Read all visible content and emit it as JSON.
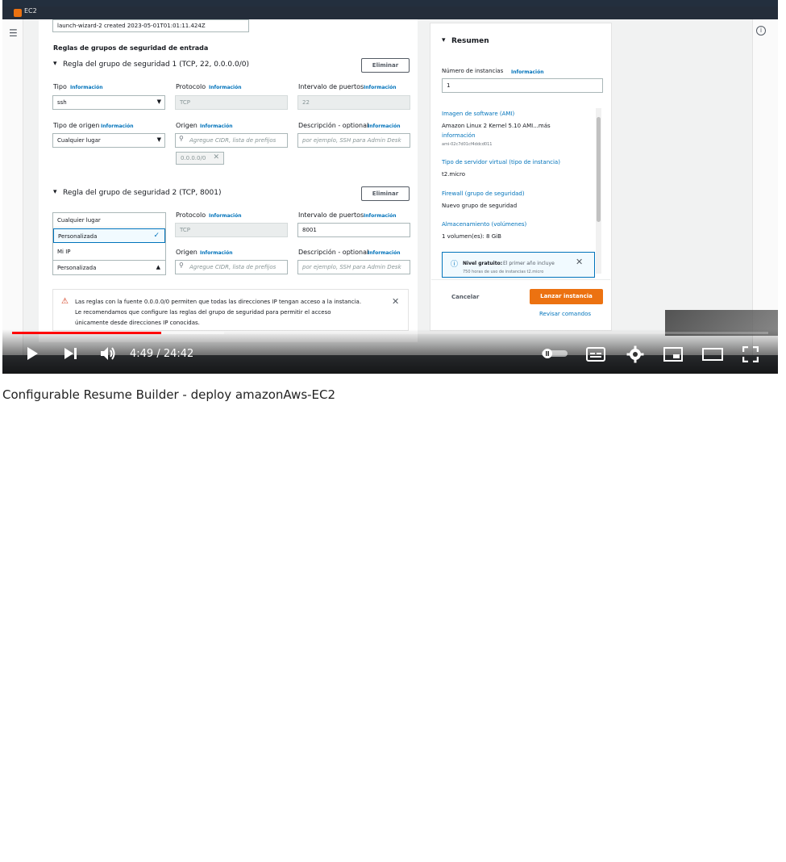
{
  "browser": {
    "tab_label": "EC2"
  },
  "main": {
    "name_value": "launch-wizard-2 created 2023-05-01T01:01:11.424Z",
    "section_title": "Reglas de grupos de seguridad de entrada",
    "info_label": "Información",
    "remove_label": "Eliminar",
    "rule1": {
      "title": "Regla del grupo de seguridad 1 (TCP, 22, 0.0.0.0/0)",
      "type_label": "Tipo",
      "type_value": "ssh",
      "protocol_label": "Protocolo",
      "protocol_value": "TCP",
      "port_label": "Intervalo de puertos",
      "port_value": "22",
      "source_type_label": "Tipo de origen",
      "source_type_value": "Cualquier lugar",
      "source_label": "Origen",
      "source_placeholder": "Agregue CIDR, lista de prefijos",
      "source_token": "0.0.0.0/0",
      "desc_label": "Descripción - optional",
      "desc_placeholder": "por ejemplo, SSH para Admin Desk"
    },
    "rule2": {
      "title": "Regla del grupo de seguridad 2 (TCP, 8001)",
      "protocol_label": "Protocolo",
      "protocol_value": "TCP",
      "port_label": "Intervalo de puertos",
      "port_value": "8001",
      "source_label": "Origen",
      "source_placeholder": "Agregue CIDR, lista de prefijos",
      "desc_label": "Descripción - optional",
      "desc_placeholder": "por ejemplo, SSH para Admin Desk",
      "dropdown_options": [
        "Cualquier lugar",
        "Personalizada",
        "Mi IP"
      ],
      "dropdown_selected": "Personalizada"
    },
    "warning": {
      "line1": "Las reglas con la fuente 0.0.0.0/0 permiten que todas las direcciones IP tengan acceso a la instancia.",
      "line2": "Le recomendamos que configure las reglas del grupo de seguridad para permitir el acceso",
      "line3": "únicamente desde direcciones IP conocidas."
    }
  },
  "summary": {
    "title": "Resumen",
    "instances_label": "Número de instancias",
    "info_label": "Información",
    "instances_value": "1",
    "ami_label": "Imagen de software (AMI)",
    "ami_value": "Amazon Linux 2 Kernel 5.10 AMI...más",
    "ami_more": "información",
    "ami_id": "ami-02c7d01cf4ddcd011",
    "instance_type_label": "Tipo de servidor virtual (tipo de instancia)",
    "instance_type_value": "t2.micro",
    "firewall_label": "Firewall (grupo de seguridad)",
    "firewall_value": "Nuevo grupo de seguridad",
    "storage_label": "Almacenamiento (volúmenes)",
    "storage_value": "1 volumen(es): 8 GiB",
    "free_tier_title": "Nivel gratuito:",
    "free_tier_text": "El primer año incluye",
    "free_tier_text2": "750 horas de uso de instancias t2.micro",
    "cancel_label": "Cancelar",
    "launch_label": "Lanzar instancia",
    "review_label": "Revisar comandos"
  },
  "player": {
    "time_current": "4:49",
    "time_separator": " / ",
    "time_total": "24:42",
    "progress_played_fraction": 0.197,
    "progress_buffered_fraction": 0.28,
    "icons": [
      "play-icon",
      "next-icon",
      "volume-icon",
      "autoplay-toggle-icon",
      "subtitles-icon",
      "settings-icon",
      "miniplayer-icon",
      "theater-icon",
      "fullscreen-icon"
    ]
  },
  "video_title": "Configurable Resume Builder - deploy amazonAws-EC2"
}
